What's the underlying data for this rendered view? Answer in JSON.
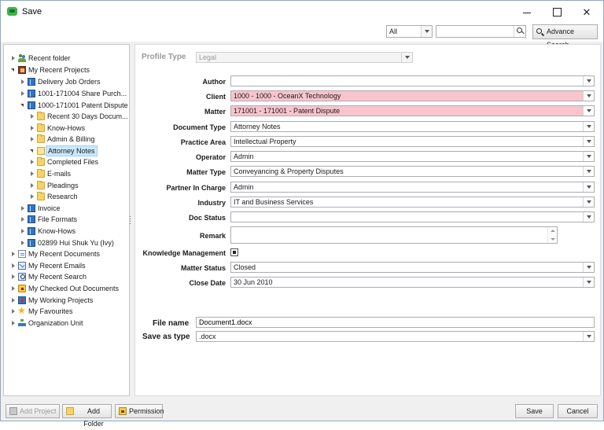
{
  "window": {
    "title": "Save",
    "minimize_label": "",
    "maximize_label": "",
    "close_label": "✕"
  },
  "toolbar": {
    "scope_value": "All",
    "search_value": "",
    "advance_search_label": "Advance Search"
  },
  "tree": {
    "items": [
      {
        "label": "Recent folder",
        "icon": "people-icon",
        "expanded": false
      },
      {
        "label": "My Recent Projects",
        "icon": "project-icon",
        "expanded": true
      },
      {
        "label": "Delivery Job Orders",
        "icon": "book-icon",
        "expanded": false
      },
      {
        "label": "1001-171004 Share Purch...",
        "icon": "book-icon",
        "expanded": false
      },
      {
        "label": "1000-171001 Patent Dispute",
        "icon": "book-icon",
        "expanded": true
      },
      {
        "label": "Recent 30 Days Docum...",
        "icon": "folder-icon",
        "expanded": false
      },
      {
        "label": "Know-Hows",
        "icon": "folder-icon",
        "expanded": false
      },
      {
        "label": "Admin & Billing",
        "icon": "folder-icon",
        "expanded": false
      },
      {
        "label": "Attorney Notes",
        "icon": "folder-open-icon",
        "expanded": true,
        "selected": true
      },
      {
        "label": "Completed Files",
        "icon": "folder-icon",
        "expanded": false
      },
      {
        "label": "E-mails",
        "icon": "folder-icon",
        "expanded": false
      },
      {
        "label": "Pleadings",
        "icon": "folder-icon",
        "expanded": false
      },
      {
        "label": "Research",
        "icon": "folder-icon",
        "expanded": false
      },
      {
        "label": "Invoice",
        "icon": "book-icon",
        "expanded": false
      },
      {
        "label": "File Formats",
        "icon": "book-icon",
        "expanded": false
      },
      {
        "label": "Know-Hows",
        "icon": "book-icon",
        "expanded": false
      },
      {
        "label": "02899 Hui Shuk Yu (Ivy)",
        "icon": "book-icon",
        "expanded": false
      },
      {
        "label": "My Recent Documents",
        "icon": "document-icon",
        "expanded": false
      },
      {
        "label": "My Recent Emails",
        "icon": "mail-icon",
        "expanded": false
      },
      {
        "label": "My Recent Search",
        "icon": "search-icon",
        "expanded": false
      },
      {
        "label": "My Checked Out Documents",
        "icon": "lock-icon",
        "expanded": false
      },
      {
        "label": "My Working Projects",
        "icon": "work-icon",
        "expanded": false
      },
      {
        "label": "My Favourites",
        "icon": "star-icon",
        "expanded": false
      },
      {
        "label": "Organization Unit",
        "icon": "org-icon",
        "expanded": false
      }
    ]
  },
  "form": {
    "profile_type_label": "Profile Type",
    "profile_type_value": "Legal",
    "fields": {
      "author": {
        "label": "Author",
        "value": ""
      },
      "client": {
        "label": "Client",
        "value": "1000 - 1000 - OceanX Technology"
      },
      "matter": {
        "label": "Matter",
        "value": "171001 - 171001 - Patent Dispute"
      },
      "document_type": {
        "label": "Document Type",
        "value": "Attorney Notes"
      },
      "practice_area": {
        "label": "Practice Area",
        "value": "Intellectual Property"
      },
      "operator": {
        "label": "Operator",
        "value": "Admin"
      },
      "matter_type": {
        "label": "Matter Type",
        "value": "Conveyancing & Property Disputes"
      },
      "partner_in_charge": {
        "label": "Partner In Charge",
        "value": "Admin"
      },
      "industry": {
        "label": "Industry",
        "value": "IT and Business Services"
      },
      "doc_status": {
        "label": "Doc Status",
        "value": ""
      },
      "remark": {
        "label": "Remark",
        "value": ""
      },
      "knowledge_management": {
        "label": "Knowledge Management"
      },
      "matter_status": {
        "label": "Matter Status",
        "value": "Closed"
      },
      "close_date": {
        "label": "Close Date",
        "value": "30 Jun 2010"
      }
    },
    "file_name_label": "File name",
    "file_name_value": "Document1.docx",
    "save_as_type_label": "Save as type",
    "save_as_type_value": ".docx"
  },
  "footer": {
    "add_project_label": "Add Project",
    "add_folder_label": "Add Folder",
    "permission_label": "Permission",
    "save_label": "Save",
    "cancel_label": "Cancel"
  },
  "colors": {
    "required_field_bg": "#f9c4cc",
    "selection_bg": "#cce8ff",
    "window_border": "#8eaac9"
  }
}
